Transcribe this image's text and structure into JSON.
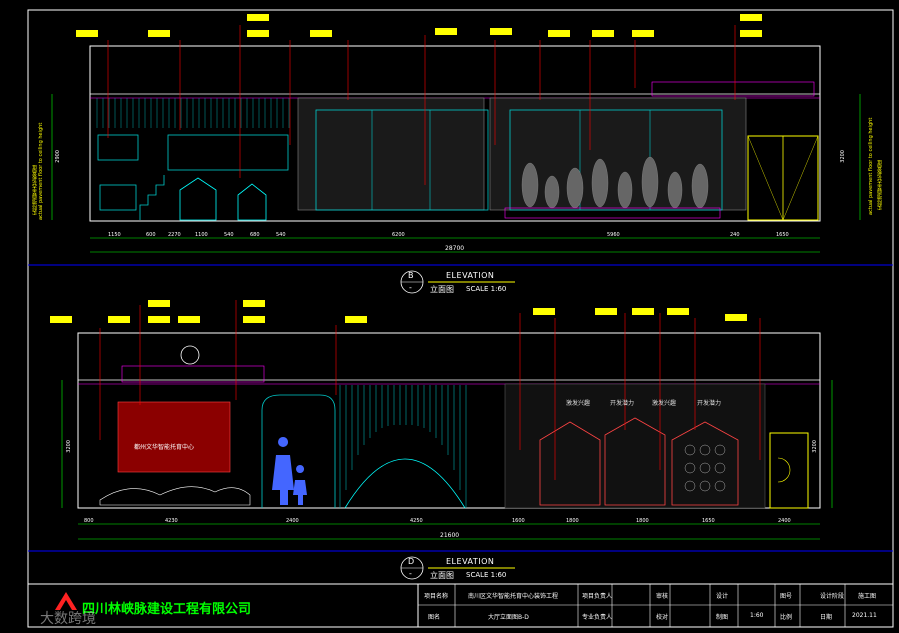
{
  "elevation_b": {
    "bubble_letter": "B",
    "bubble_sub": "-",
    "title_en": "ELEVATION",
    "title_cn": "立面图",
    "scale": "SCALE 1:60",
    "total_dim": "28700",
    "dims": [
      "1150",
      "600",
      "2270",
      "1100",
      "540",
      "680",
      "540",
      "6200",
      "",
      "5960",
      "",
      "240",
      "1650"
    ],
    "side_left": "actual pavement floor to ceiling height",
    "side_left_cn": "实际地面至天花板高度",
    "side_right": "actual pavement floor to ceiling height",
    "side_right_cn": "实际地面至天花板高度",
    "vdims": [
      "2900",
      "3200"
    ]
  },
  "elevation_d": {
    "bubble_letter": "D",
    "bubble_sub": "-",
    "title_en": "ELEVATION",
    "title_cn": "立面图",
    "scale": "SCALE 1:60",
    "total_dim": "21600",
    "dims": [
      "800",
      "4230",
      "",
      "2400",
      "",
      "4250",
      "",
      "1600",
      "1800",
      "1800",
      "1650",
      "",
      "2400"
    ],
    "wall_text": "都州文华智能托育中心",
    "slogans": [
      "激发兴趣",
      "开发潜力",
      "激发兴趣",
      "开发潜力"
    ],
    "vdims": [
      "3200",
      "3200"
    ]
  },
  "title_block": {
    "company": "四川林峡脉建设工程有限公司",
    "cells": [
      "项目名称",
      "南川区文华智能托育中心装饰工程",
      "项目负责人",
      "",
      "审核",
      "",
      "设计",
      "",
      "图号",
      "",
      "设计阶段",
      "施工图"
    ],
    "row2": [
      "图名",
      "大厅立面图B-D",
      "专业负责人",
      "",
      "校对",
      "",
      "制图",
      "",
      "比例",
      "1:60",
      "日期",
      "2021.11"
    ]
  },
  "watermark": "大数跨境",
  "colors": {
    "accent": "#ffff00",
    "lines": "#00ffff",
    "dims": "#ff0000",
    "green": "#00ff00",
    "magenta": "#ff00ff"
  }
}
